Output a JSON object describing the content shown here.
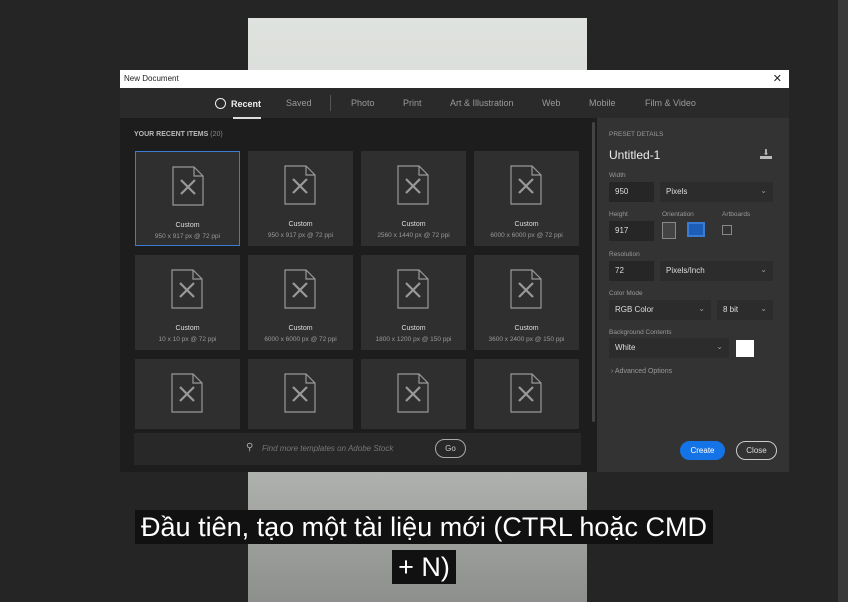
{
  "dialog": {
    "title": "New Document",
    "close": "✕"
  },
  "tabs": [
    "Recent",
    "Saved",
    "Photo",
    "Print",
    "Art & Illustration",
    "Web",
    "Mobile",
    "Film & Video"
  ],
  "recent": {
    "heading": "YOUR RECENT ITEMS",
    "count": "(20)",
    "items": [
      {
        "name": "Custom",
        "dims": "950 x 917 px @ 72 ppi"
      },
      {
        "name": "Custom",
        "dims": "950 x 917 px @ 72 ppi"
      },
      {
        "name": "Custom",
        "dims": "2560 x 1440 px @ 72 ppi"
      },
      {
        "name": "Custom",
        "dims": "6000 x 6000 px @ 72 ppi"
      },
      {
        "name": "Custom",
        "dims": "10 x 10 px @ 72 ppi"
      },
      {
        "name": "Custom",
        "dims": "6000 x 6000 px @ 72 ppi"
      },
      {
        "name": "Custom",
        "dims": "1800 x 1200 px @ 150 ppi"
      },
      {
        "name": "Custom",
        "dims": "3600 x 2400 px @ 150 ppi"
      }
    ]
  },
  "search": {
    "placeholder": "Find more templates on Adobe Stock",
    "go": "Go"
  },
  "preset": {
    "heading": "PRESET DETAILS",
    "name": "Untitled-1",
    "width_label": "Width",
    "width": "950",
    "width_unit": "Pixels",
    "height_label": "Height",
    "height": "917",
    "orientation_label": "Orientation",
    "artboards_label": "Artboards",
    "resolution_label": "Resolution",
    "resolution": "72",
    "resolution_unit": "Pixels/Inch",
    "color_mode_label": "Color Mode",
    "color_mode": "RGB Color",
    "bit_depth": "8 bit",
    "bg_label": "Background Contents",
    "bg": "White",
    "advanced": "Advanced Options",
    "create": "Create",
    "close": "Close"
  },
  "subtitle": {
    "line1": "Đầu tiên, tạo một tài liệu mới (CTRL hoặc CMD",
    "line2": "+ N)"
  }
}
